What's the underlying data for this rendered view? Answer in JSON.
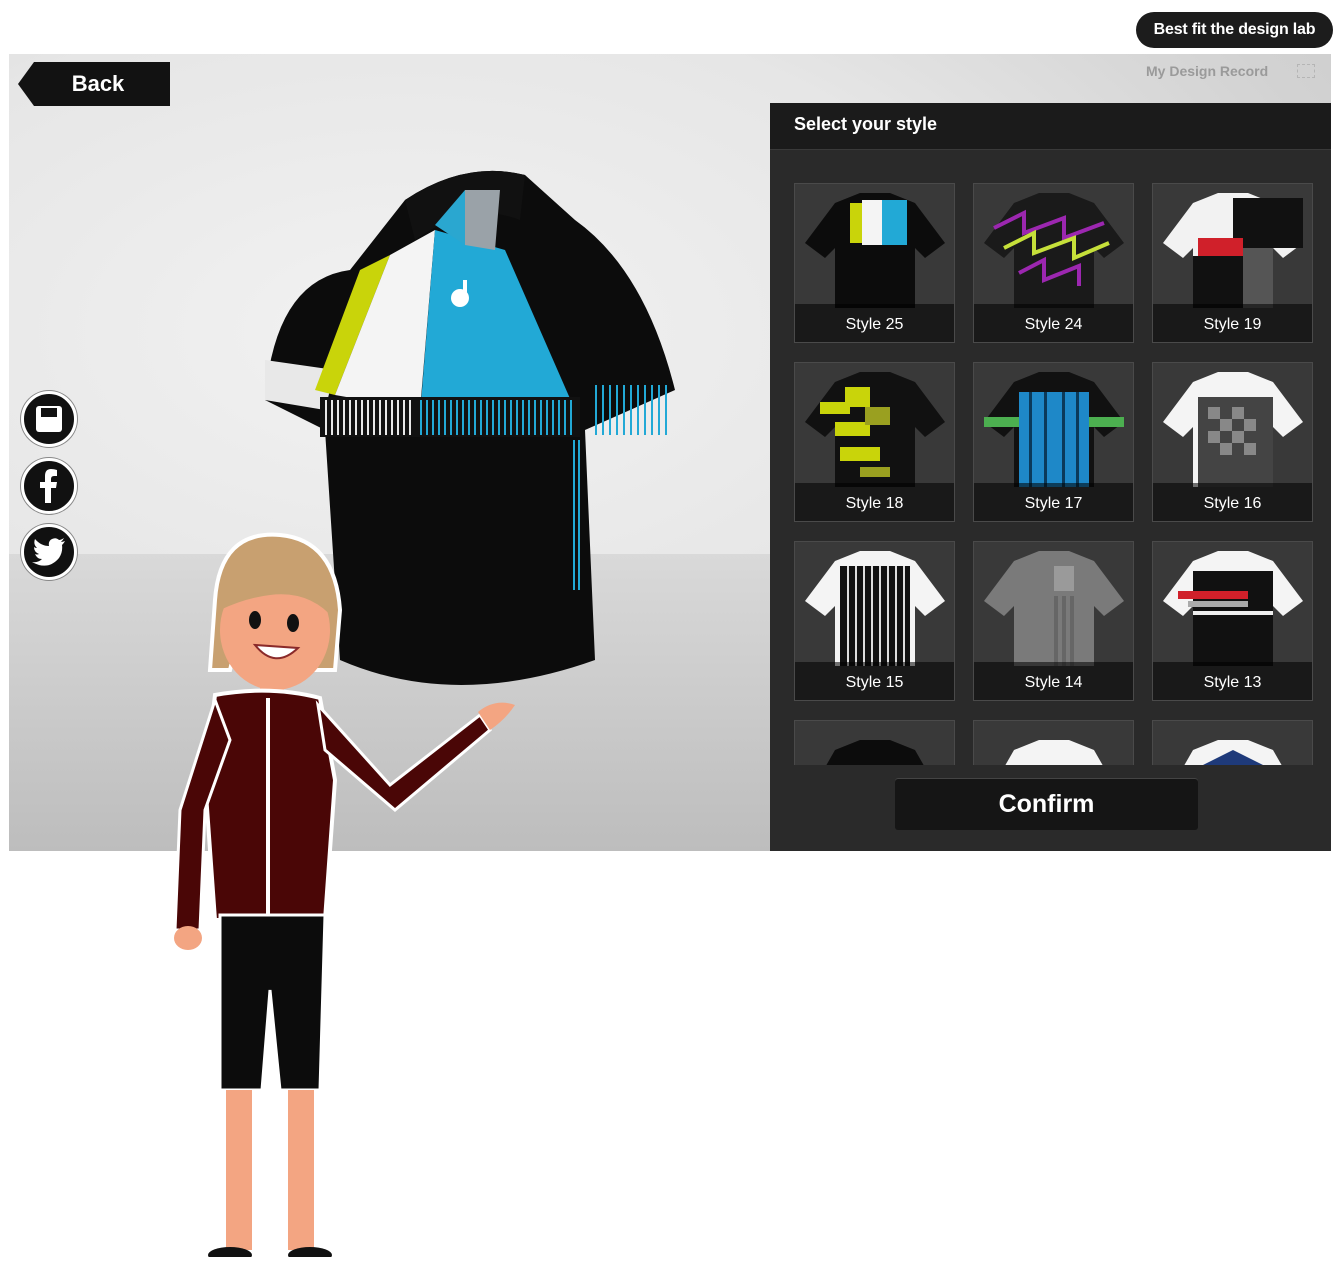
{
  "header": {
    "brand_pill": "Best fit the design lab"
  },
  "toolbar": {
    "back_label": "Back",
    "record_label": "My Design Record"
  },
  "panel": {
    "title": "Select your style",
    "styles": [
      {
        "label": "Style 25",
        "theme": "cyan-white-black"
      },
      {
        "label": "Style 24",
        "theme": "purple-lime-zigzag"
      },
      {
        "label": "Style 19",
        "theme": "white-black-red-grey"
      },
      {
        "label": "Style 18",
        "theme": "lime-camo"
      },
      {
        "label": "Style 17",
        "theme": "blue-green-stripes"
      },
      {
        "label": "Style 16",
        "theme": "grey-checker"
      },
      {
        "label": "Style 15",
        "theme": "black-white-pinstripe"
      },
      {
        "label": "Style 14",
        "theme": "grey-ghost"
      },
      {
        "label": "Style 13",
        "theme": "black-red-white"
      }
    ],
    "confirm_label": "Confirm"
  },
  "social": [
    "save-icon",
    "facebook-icon",
    "twitter-icon"
  ],
  "colors": {
    "accent_cyan": "#22a9d6",
    "accent_lime": "#c9d40a",
    "dark": "#121212"
  }
}
